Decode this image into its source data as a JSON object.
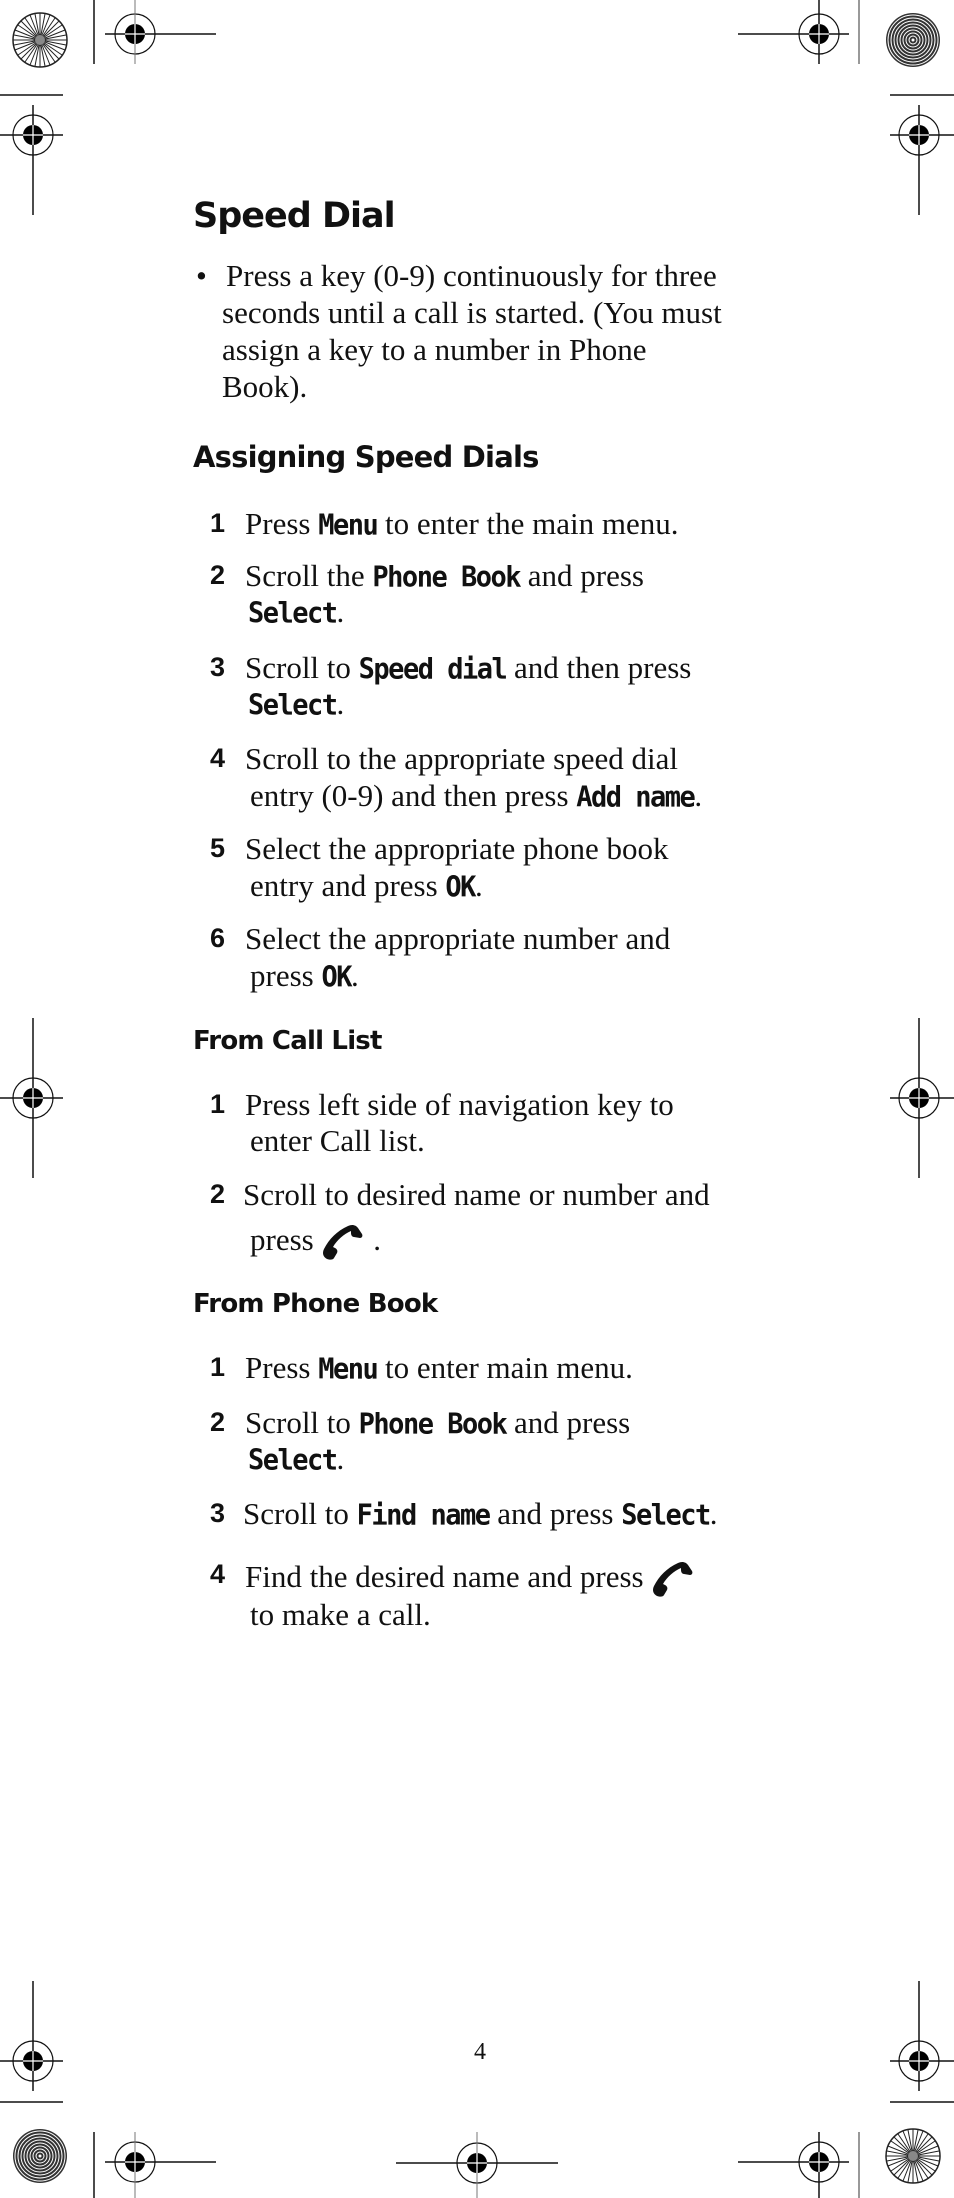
{
  "page": {
    "number": "4"
  },
  "speed_dial": {
    "title": "Speed Dial",
    "bullet": {
      "lines": [
        "Press a key (0-9) continuously for three",
        "seconds until a call is started. (You must",
        "assign a key to a number in Phone",
        "Book)."
      ]
    }
  },
  "assigning": {
    "title": "Assigning Speed Dials",
    "steps": [
      {
        "num": "1",
        "pre": "Press ",
        "key": "Menu",
        "post": " to enter the main menu."
      },
      {
        "num": "2",
        "pre": "Scroll the ",
        "key": "Phone Book",
        "post": " and press",
        "cont_key": "Select",
        "cont_post": "."
      },
      {
        "num": "3",
        "pre": "Scroll to ",
        "key": "Speed dial",
        "post": " and then press",
        "cont_key": "Select",
        "cont_post": "."
      },
      {
        "num": "4",
        "text": "Scroll to the appropriate speed dial",
        "cont_pre": "entry (0-9) and then press ",
        "cont_key": "Add name",
        "cont_post": "."
      },
      {
        "num": "5",
        "text": "Select the appropriate phone book",
        "cont_pre": "entry and press ",
        "cont_key": "OK",
        "cont_post": "."
      },
      {
        "num": "6",
        "text": "Select the appropriate number and",
        "cont_pre": "press ",
        "cont_key": "OK",
        "cont_post": "."
      }
    ]
  },
  "call_list": {
    "title": "From Call List",
    "steps": [
      {
        "num": "1",
        "text": "Press left side of navigation key to",
        "cont": "enter Call list."
      },
      {
        "num": "2",
        "text": "Scroll to desired name or number and",
        "cont_pre": "press ",
        "icon": "phone-send-icon",
        "cont_post": " ."
      }
    ]
  },
  "phone_book": {
    "title": "From Phone Book",
    "steps": [
      {
        "num": "1",
        "pre": "Press ",
        "key": "Menu",
        "post": " to enter main menu."
      },
      {
        "num": "2",
        "pre": "Scroll to ",
        "key": "Phone Book",
        "post": " and press",
        "cont_key": "Select",
        "cont_post": "."
      },
      {
        "num": "3",
        "pre": "Scroll to ",
        "key": "Find name",
        "mid": " and press ",
        "key2": "Select",
        "post": "."
      },
      {
        "num": "4",
        "text": "Find the desired name and press ",
        "icon": "phone-send-icon",
        "cont": "to make a call."
      }
    ]
  }
}
